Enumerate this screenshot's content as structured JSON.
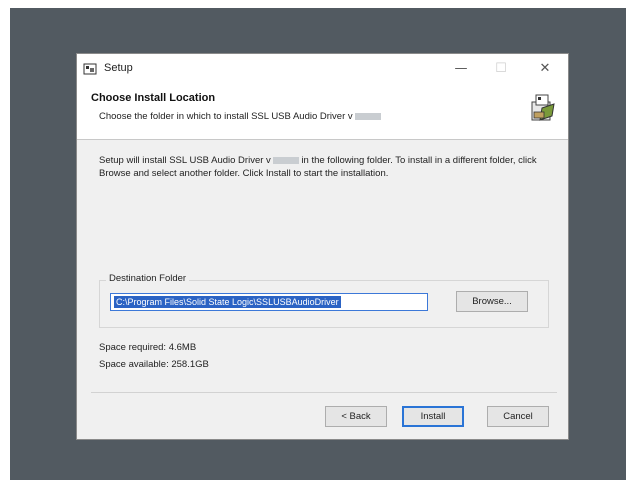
{
  "window": {
    "title": "Setup",
    "minimize_glyph": "—",
    "maximize_glyph": "☐",
    "close_glyph": "✕"
  },
  "header": {
    "title": "Choose Install Location",
    "subtitle": "Choose the folder in which to install SSL USB Audio Driver v"
  },
  "description": {
    "part1": "Setup will install SSL USB Audio Driver v",
    "part2": "in the following folder. To install in a different folder, click Browse and select another folder. Click Install to start the installation."
  },
  "destination": {
    "label": "Destination Folder",
    "path": "C:\\Program Files\\Solid State Logic\\SSLUSBAudioDriver",
    "browse_label": "Browse..."
  },
  "space": {
    "required": "Space required: 4.6MB",
    "available": "Space available: 258.1GB"
  },
  "buttons": {
    "back": "< Back",
    "install": "Install",
    "cancel": "Cancel"
  },
  "icons": {
    "app": "installer-icon",
    "header": "installer-box-icon"
  },
  "colors": {
    "backdrop": "#525a61",
    "selection": "#2b63c4",
    "default_button_border": "#2a74d6"
  }
}
